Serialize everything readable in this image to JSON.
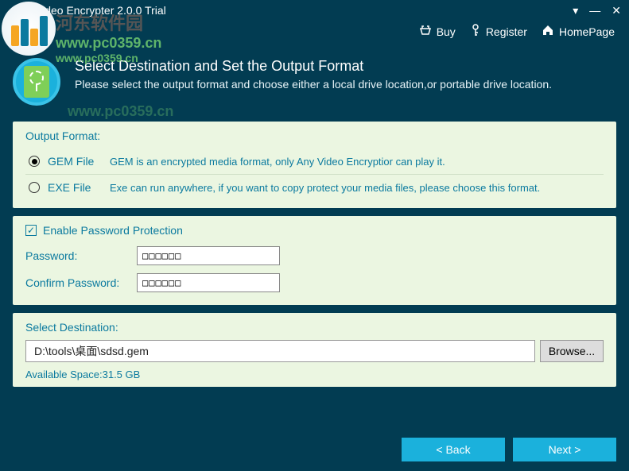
{
  "window": {
    "title": "Any Video Encrypter 2.0.0 Trial"
  },
  "toolbar": {
    "buy": "Buy",
    "register": "Register",
    "homepage": "HomePage"
  },
  "header": {
    "title": "Select Destination and Set the Output Format",
    "subtitle": "Please select the output format and choose either a local drive location,or portable drive location."
  },
  "output_format": {
    "title": "Output Format:",
    "options": [
      {
        "label": "GEM File",
        "desc": "GEM is an encrypted media format, only Any Video Encryptior can play it.",
        "selected": true
      },
      {
        "label": "EXE File",
        "desc": "Exe can run anywhere, if you want to copy protect your media files, please choose this format.",
        "selected": false
      }
    ]
  },
  "password_section": {
    "enable_label": "Enable Password Protection",
    "enabled": true,
    "password_label": "Password:",
    "password_value": "□□□□□□",
    "confirm_label": "Confirm Password:",
    "confirm_value": "□□□□□□"
  },
  "destination": {
    "label": "Select Destination:",
    "path": "D:\\tools\\桌面\\sdsd.gem",
    "browse_label": "Browse...",
    "available_space": "Available Space:31.5 GB"
  },
  "footer": {
    "back": "< Back",
    "next": "Next >"
  },
  "watermark": {
    "cn": "河东软件园",
    "url": "www.pc0359.cn"
  }
}
